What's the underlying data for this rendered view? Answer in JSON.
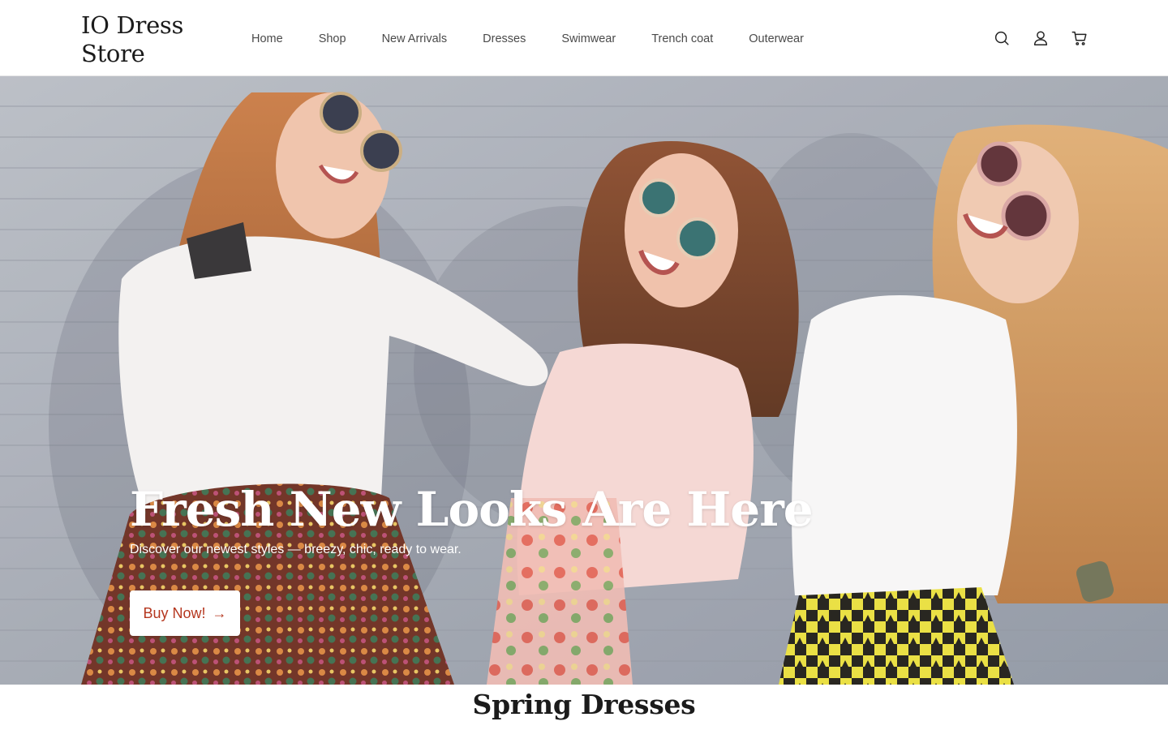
{
  "brand": {
    "line1": "IO Dress",
    "line2": "Store"
  },
  "nav": {
    "items": [
      {
        "label": "Home"
      },
      {
        "label": "Shop"
      },
      {
        "label": "New Arrivals"
      },
      {
        "label": "Dresses"
      },
      {
        "label": "Swimwear"
      },
      {
        "label": "Trench coat"
      },
      {
        "label": "Outerwear"
      }
    ]
  },
  "header_icons": [
    "search-icon",
    "account-icon",
    "cart-icon"
  ],
  "hero": {
    "title": "Fresh New Looks Are Here",
    "subtitle": "Discover our newest styles — breezy, chic, ready to wear.",
    "cta_label": "Buy Now!",
    "cta_icon": "arrow-right-icon"
  },
  "section": {
    "title": "Spring Dresses"
  },
  "colors": {
    "accent": "#b5371f",
    "text": "#1b1b1b",
    "nav_text": "#4a4a4a",
    "background": "#ffffff"
  }
}
